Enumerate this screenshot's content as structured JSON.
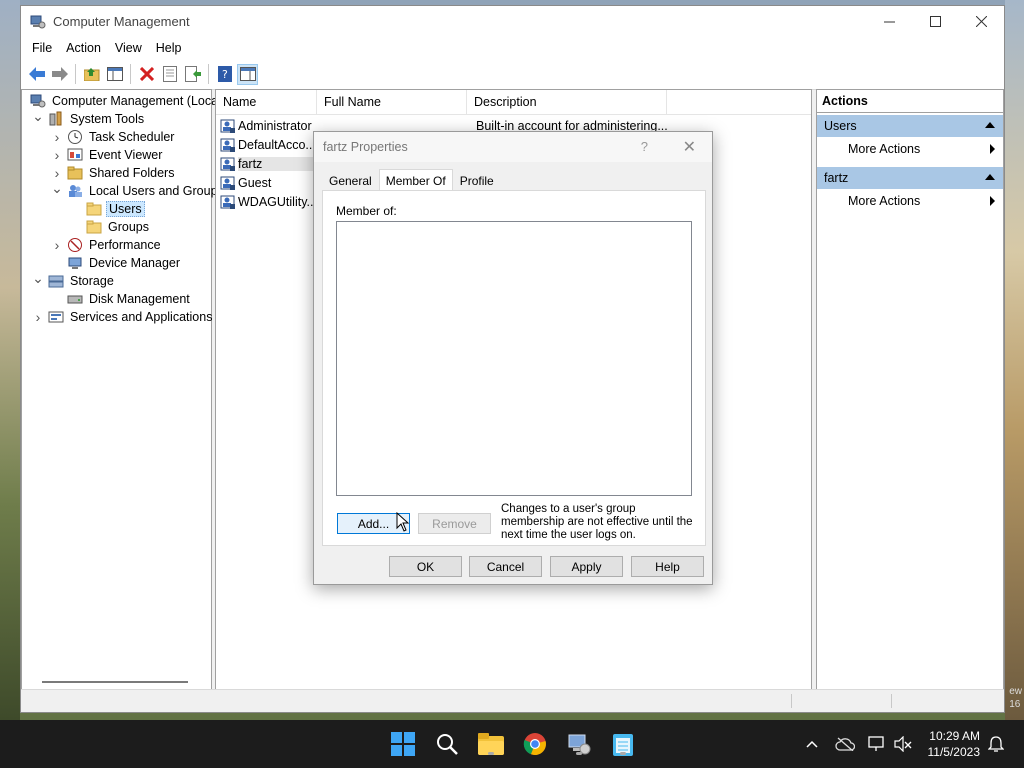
{
  "window": {
    "title": "Computer Management",
    "menu": [
      "File",
      "Action",
      "View",
      "Help"
    ]
  },
  "tree": {
    "items": [
      {
        "label": "Computer Management (Local",
        "level": 0,
        "expander": "",
        "icon": "computer-management-icon"
      },
      {
        "label": "System Tools",
        "level": 1,
        "expander": "expanded",
        "icon": "system-tools-icon"
      },
      {
        "label": "Task Scheduler",
        "level": 2,
        "expander": "collapsed",
        "icon": "clock-icon"
      },
      {
        "label": "Event Viewer",
        "level": 2,
        "expander": "collapsed",
        "icon": "event-viewer-icon"
      },
      {
        "label": "Shared Folders",
        "level": 2,
        "expander": "collapsed",
        "icon": "shared-folder-icon"
      },
      {
        "label": "Local Users and Groups",
        "level": 2,
        "expander": "expanded",
        "icon": "users-groups-icon"
      },
      {
        "label": "Users",
        "level": 3,
        "expander": "",
        "icon": "folder-icon",
        "selected": true
      },
      {
        "label": "Groups",
        "level": 3,
        "expander": "",
        "icon": "folder-icon"
      },
      {
        "label": "Performance",
        "level": 2,
        "expander": "collapsed",
        "icon": "performance-icon"
      },
      {
        "label": "Device Manager",
        "level": 2,
        "expander": "",
        "icon": "device-manager-icon"
      },
      {
        "label": "Storage",
        "level": 1,
        "expander": "expanded",
        "icon": "storage-icon"
      },
      {
        "label": "Disk Management",
        "level": 2,
        "expander": "",
        "icon": "disk-management-icon"
      },
      {
        "label": "Services and Applications",
        "level": 1,
        "expander": "collapsed",
        "icon": "services-icon"
      }
    ]
  },
  "list": {
    "columns": [
      "Name",
      "Full Name",
      "Description"
    ],
    "rows": [
      {
        "name": "Administrator",
        "description": "Built-in account for administering..."
      },
      {
        "name": "DefaultAcco...",
        "description": ""
      },
      {
        "name": "fartz",
        "description": "",
        "selected": true
      },
      {
        "name": "Guest",
        "description": ""
      },
      {
        "name": "WDAGUtility...",
        "description": ""
      }
    ]
  },
  "actions": {
    "header": "Actions",
    "sections": [
      {
        "title": "Users",
        "items": [
          "More Actions"
        ]
      },
      {
        "title": "fartz",
        "items": [
          "More Actions"
        ]
      }
    ]
  },
  "dialog": {
    "title": "fartz Properties",
    "help_glyph": "?",
    "close_glyph": "✕",
    "tabs": [
      "General",
      "Member Of",
      "Profile"
    ],
    "active_tab": "Member Of",
    "member_of_label": "Member of:",
    "add_label": "Add...",
    "remove_label": "Remove",
    "note": "Changes to a user's group membership are not effective until the next time the user logs on.",
    "ok_label": "OK",
    "cancel_label": "Cancel",
    "apply_label": "Apply",
    "help_label": "Help"
  },
  "desktop": {
    "edge_text_1": "ew",
    "edge_text_2": "16"
  },
  "taskbar": {
    "time": "10:29 AM",
    "date": "11/5/2023"
  },
  "colors": {
    "accent": "#0078d7",
    "selection": "#cce8ff",
    "actions_section": "#a9c7e5"
  }
}
